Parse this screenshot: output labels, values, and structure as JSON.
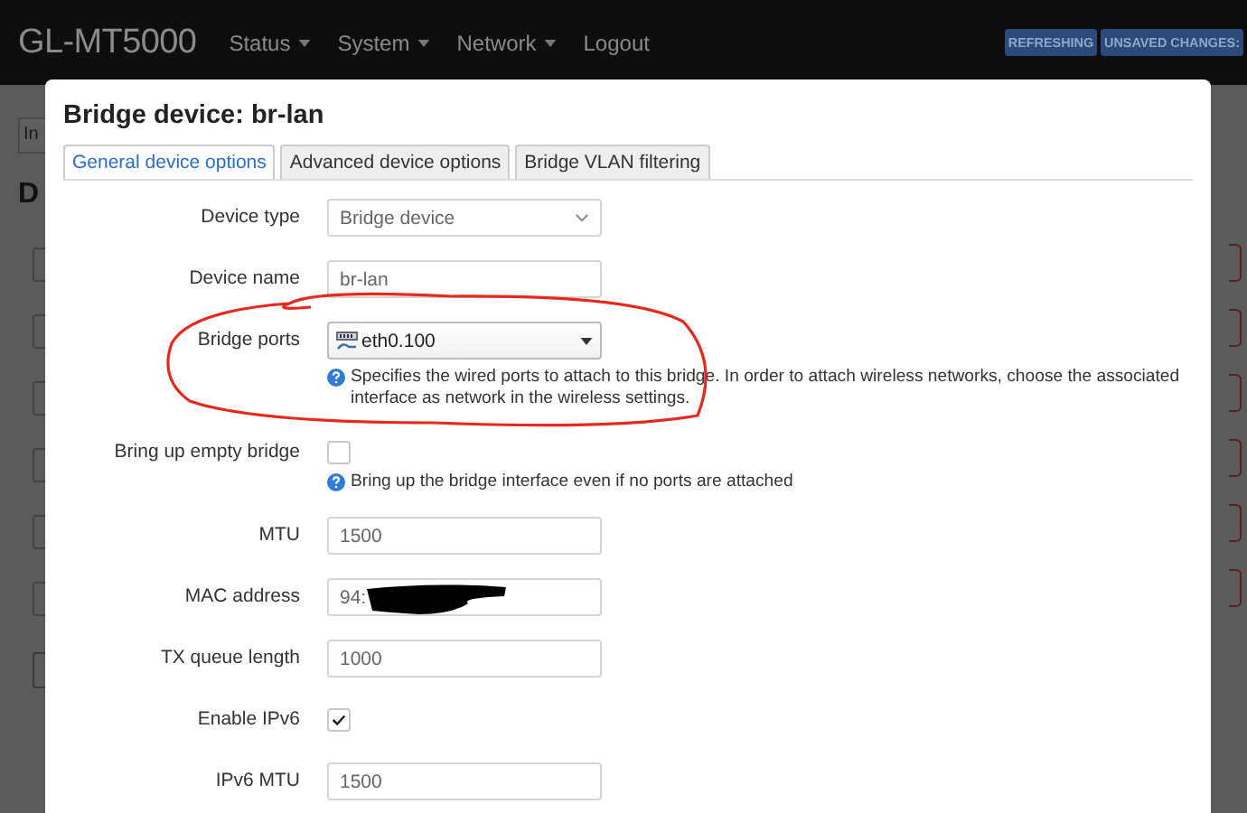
{
  "header": {
    "brand": "GL-MT5000",
    "menu": [
      {
        "label": "Status",
        "dropdown": true
      },
      {
        "label": "System",
        "dropdown": true
      },
      {
        "label": "Network",
        "dropdown": true
      },
      {
        "label": "Logout",
        "dropdown": false
      }
    ],
    "badges": [
      "REFRESHING",
      "UNSAVED CHANGES:"
    ]
  },
  "background": {
    "tab_label": "In",
    "heading": "D"
  },
  "modal": {
    "title": "Bridge device: br-lan",
    "tabs": [
      {
        "label": "General device options",
        "selected": true
      },
      {
        "label": "Advanced device options",
        "selected": false
      },
      {
        "label": "Bridge VLAN filtering",
        "selected": false
      }
    ],
    "fields": [
      {
        "kind": "select",
        "label": "Device type",
        "value": "Bridge device"
      },
      {
        "kind": "input",
        "label": "Device name",
        "value": "br-lan"
      },
      {
        "kind": "dropdown",
        "label": "Bridge ports",
        "value": "eth0.100",
        "help": "Specifies the wired ports to attach to this bridge. In order to attach wireless networks, choose the associated interface as network in the wireless settings."
      },
      {
        "kind": "checkbox",
        "label": "Bring up empty bridge",
        "checked": false,
        "help": "Bring up the bridge interface even if no ports are attached"
      },
      {
        "kind": "input",
        "label": "MTU",
        "value": "1500"
      },
      {
        "kind": "input",
        "label": "MAC address",
        "value": "94:"
      },
      {
        "kind": "input",
        "label": "TX queue length",
        "value": "1000"
      },
      {
        "kind": "checkbox",
        "label": "Enable IPv6",
        "checked": true
      },
      {
        "kind": "input",
        "label": "IPv6 MTU",
        "value": "1500"
      }
    ]
  }
}
